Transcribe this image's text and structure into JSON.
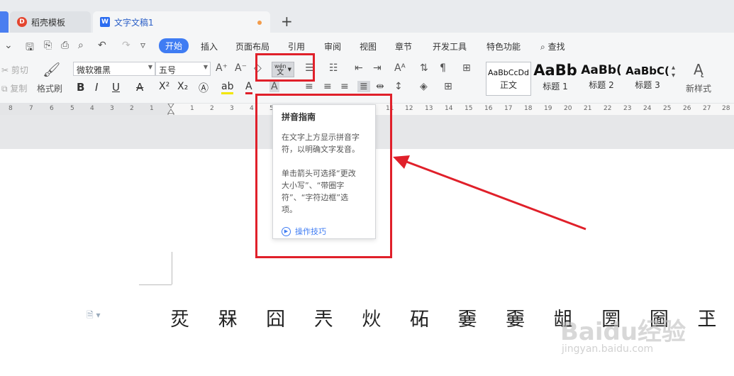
{
  "tabs": [
    {
      "label": "稻壳模板"
    },
    {
      "label": "文字文稿1"
    }
  ],
  "menu": [
    "开始",
    "插入",
    "页面布局",
    "引用",
    "审阅",
    "视图",
    "章节",
    "开发工具",
    "特色功能"
  ],
  "search_label": "查找",
  "ribbon": {
    "cut": "剪切",
    "copy": "复制",
    "format_painter": "格式刷",
    "font_name": "微软雅黑",
    "font_size": "五号",
    "phonetic_top": "wén",
    "phonetic_bottom": "文",
    "styles": [
      {
        "sample": "AaBbCcDd",
        "label": "正文"
      },
      {
        "sample": "AaBb",
        "label": "标题 1"
      },
      {
        "sample": "AaBb(",
        "label": "标题 2"
      },
      {
        "sample": "AaBbC(",
        "label": "标题 3"
      }
    ],
    "new_style": "新样式"
  },
  "ruler_left": [
    "8",
    "7",
    "6",
    "5",
    "4",
    "3",
    "2",
    "1"
  ],
  "ruler_right": [
    "1",
    "2",
    "3",
    "4",
    "5",
    "6",
    "7",
    "8",
    "9",
    "10",
    "11",
    "12",
    "13",
    "14",
    "15",
    "16",
    "17",
    "18",
    "19",
    "20",
    "21",
    "22",
    "23",
    "24",
    "25",
    "26",
    "27",
    "28"
  ],
  "tooltip": {
    "title": "拼音指南",
    "line1": "在文字上方显示拼音字",
    "line2": "符，以明确文字发音。",
    "line3": "单击箭头可选择“更改",
    "line4": "大小写”、“带圈字",
    "line5": "符”、“字符边框”选",
    "line6": "项。",
    "link": "操作技巧"
  },
  "document_text": "烎 槑 囧 兲 炏 砳 嫑 嫑 龃 圐 圙 玊",
  "watermark": "Baidu经验",
  "watermark_sub": "jingyan.baidu.com",
  "colors": {
    "accent": "#3f7cf3",
    "annotation": "#e0202a"
  }
}
